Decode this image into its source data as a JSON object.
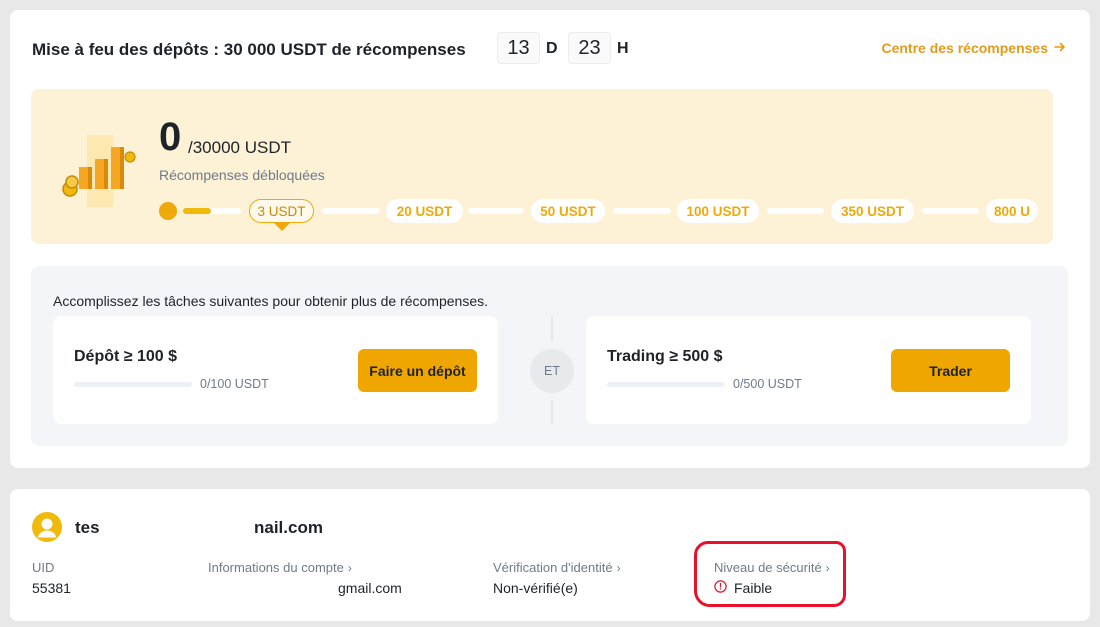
{
  "campaign": {
    "title": "Mise à feu des dépôts : 30 000 USDT de récompenses",
    "timer_days": "13",
    "timer_days_unit": "D",
    "timer_hours": "23",
    "timer_hours_unit": "H",
    "rewards_link": "Centre des récompenses"
  },
  "progress": {
    "current": "0",
    "total": "/30000 USDT",
    "label": "Récompenses débloquées",
    "milestones": [
      "3 USDT",
      "20 USDT",
      "50 USDT",
      "100 USDT",
      "350 USDT",
      "800 U"
    ],
    "active_index": 0
  },
  "tasks": {
    "heading": "Accomplissez les tâches suivantes pour obtenir plus de récompenses.",
    "deposit": {
      "title": "Dépôt ≥ 100 $",
      "progress": "0/100 USDT",
      "fraction": 0,
      "button": "Faire un dépôt"
    },
    "connector": "ET",
    "trading": {
      "title": "Trading ≥ 500 $",
      "progress": "0/500 USDT",
      "fraction": 0,
      "button": "Trader"
    }
  },
  "account": {
    "name_prefix": "tes",
    "name_suffix": "nail.com",
    "uid_label": "UID",
    "uid_value": "55381",
    "info_label": "Informations du compte",
    "info_value": "ɡmail.com",
    "kyc_label": "Vérification d'identité",
    "kyc_value": "Non-vérifié(e)",
    "security_label": "Niveau de sécurité",
    "security_value": "Faible"
  },
  "colors": {
    "accent": "#f0a600",
    "link": "#e39b1b",
    "panel_bg": "#fdf1d6",
    "warning": "#e8102a"
  },
  "icons": [
    "arrow-right-icon",
    "coins-bars-icon",
    "avatar-icon",
    "chevron-right-icon",
    "warning-circle-icon"
  ]
}
